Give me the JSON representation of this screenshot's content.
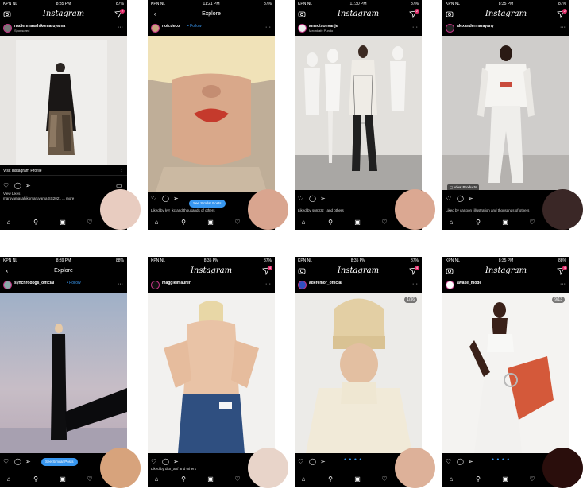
{
  "status": {
    "carrier": "KPN NL",
    "battery_a": "87%",
    "battery_b": "88%"
  },
  "screens": [
    {
      "time": "8:35 PM",
      "title": "Instagram",
      "username": "nadienmasahikomaruyama",
      "subtitle": "Sponsored",
      "visit_label": "Visit Instagram Profile",
      "meta_line1": "View Likes",
      "meta_line2": "maruyamasahikomaruyama SS2021 ... more",
      "swatch": "#e8ccc0",
      "badge": "2"
    },
    {
      "time": "11:21 PM",
      "title": "Explore",
      "username": "noir.deco",
      "follow": "• Follow",
      "pill": "See Similar Posts",
      "meta_line1": "Liked by kyr_kc and thousands of others",
      "swatch": "#d9a58f"
    },
    {
      "time": "11:30 PM",
      "title": "Instagram",
      "username": "ameotsonvanje",
      "subtitle": "Mednkafe Pundo",
      "meta_line1": "Liked by surprzz_ and others",
      "swatch": "#dba892",
      "badge": "2"
    },
    {
      "time": "8:35 PM",
      "title": "Instagram",
      "username": "alexandermarayany",
      "view_products": "View Products",
      "meta_line1": "Liked by cartoon_illustration and thousands of others",
      "swatch": "#3a2726",
      "badge": "2"
    },
    {
      "time": "8:39 PM",
      "title": "Explore",
      "username": "synchrodogs_official",
      "follow": "• Follow",
      "pill": "See Similar Posts",
      "swatch": "#d7a37c"
    },
    {
      "time": "8:35 PM",
      "title": "Instagram",
      "username": "maggielmaurer",
      "meta_line1": "Liked by dior_artf and others",
      "swatch": "#e8d4c9",
      "badge": "4"
    },
    {
      "time": "8:35 PM",
      "title": "Instagram",
      "username": "aderemor_official",
      "counter": "1/36",
      "swatch": "#ddb199",
      "badge": "4"
    },
    {
      "time": "8:35 PM",
      "title": "Instagram",
      "username": "awake_mode",
      "counter": "9/13",
      "swatch": "#2a0e0c",
      "badge": "4"
    }
  ]
}
